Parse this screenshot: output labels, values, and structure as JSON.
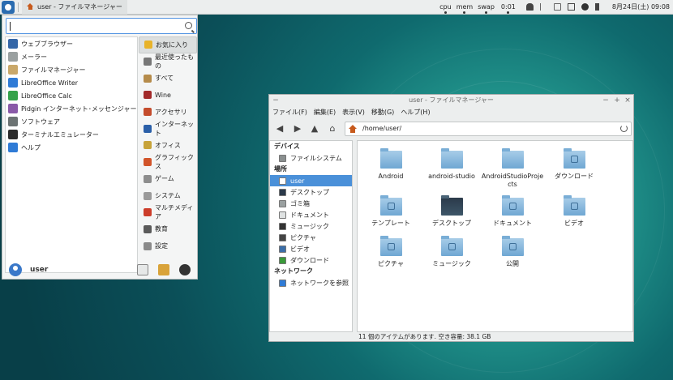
{
  "panel": {
    "task_title": "user - ファイルマネージャー",
    "monitors": [
      "cpu",
      "mem",
      "swap"
    ],
    "uptime": "0:01",
    "clock": "8月24日(土) 09:08"
  },
  "menu": {
    "search": {
      "value": "",
      "placeholder": ""
    },
    "favorites": [
      {
        "label": "ウェブブラウザー",
        "icon": "web-browser-icon",
        "color": "#3567a8"
      },
      {
        "label": "メーラー",
        "icon": "mail-icon",
        "color": "#9aa0a0"
      },
      {
        "label": "ファイルマネージャー",
        "icon": "file-manager-icon",
        "color": "#c9a86a"
      },
      {
        "label": "LibreOffice Writer",
        "icon": "writer-icon",
        "color": "#2f7bd6"
      },
      {
        "label": "LibreOffice Calc",
        "icon": "calc-icon",
        "color": "#35a24a"
      },
      {
        "label": "Pidgin インターネット･メッセンジャー",
        "icon": "pidgin-icon",
        "color": "#8a5aa8"
      },
      {
        "label": "ソフトウェア",
        "icon": "software-icon",
        "color": "#6c7373"
      },
      {
        "label": "ターミナルエミュレーター",
        "icon": "terminal-icon",
        "color": "#2b2b2b"
      },
      {
        "label": "ヘルプ",
        "icon": "help-icon",
        "color": "#2f7bd6"
      }
    ],
    "categories": [
      {
        "label": "お気に入り",
        "icon": "star-icon",
        "color": "#e8b32a",
        "active": true
      },
      {
        "label": "最近使ったもの",
        "icon": "clock-icon",
        "color": "#777777"
      },
      {
        "label": "すべて",
        "icon": "all-apps-icon",
        "color": "#b58b4a"
      },
      {
        "label": "Wine",
        "icon": "wine-icon",
        "color": "#a22a2a"
      },
      {
        "label": "アクセサリ",
        "icon": "accessories-icon",
        "color": "#c44c2c"
      },
      {
        "label": "インターネット",
        "icon": "internet-icon",
        "color": "#2a5fa8"
      },
      {
        "label": "オフィス",
        "icon": "office-icon",
        "color": "#c7a33a"
      },
      {
        "label": "グラフィックス",
        "icon": "graphics-icon",
        "color": "#d1542a"
      },
      {
        "label": "ゲーム",
        "icon": "games-icon",
        "color": "#8d8d8d"
      },
      {
        "label": "システム",
        "icon": "system-icon",
        "color": "#9a9a9a"
      },
      {
        "label": "マルチメディア",
        "icon": "multimedia-icon",
        "color": "#cc3d2a"
      },
      {
        "label": "教育",
        "icon": "education-icon",
        "color": "#5a5a5a"
      },
      {
        "label": "設定",
        "icon": "settings-icon",
        "color": "#8a8a8a"
      }
    ],
    "user": "user"
  },
  "filemanager": {
    "title": "user - ファイルマネージャー",
    "menubar": [
      "ファイル(F)",
      "編集(E)",
      "表示(V)",
      "移動(G)",
      "ヘルプ(H)"
    ],
    "path": "/home/user/",
    "sidebar": {
      "devices_header": "デバイス",
      "devices": [
        {
          "label": "ファイルシステム",
          "icon": "drive-icon"
        }
      ],
      "places_header": "場所",
      "places": [
        {
          "label": "user",
          "icon": "home-icon",
          "active": true
        },
        {
          "label": "デスクトップ",
          "icon": "desktop-icon"
        },
        {
          "label": "ゴミ箱",
          "icon": "trash-icon"
        },
        {
          "label": "ドキュメント",
          "icon": "documents-icon"
        },
        {
          "label": "ミュージック",
          "icon": "music-icon"
        },
        {
          "label": "ピクチャ",
          "icon": "pictures-icon"
        },
        {
          "label": "ビデオ",
          "icon": "videos-icon"
        },
        {
          "label": "ダウンロード",
          "icon": "downloads-icon"
        }
      ],
      "network_header": "ネットワーク",
      "network": [
        {
          "label": "ネットワークを参照",
          "icon": "network-icon"
        }
      ]
    },
    "files": [
      {
        "label": "Android",
        "icon": "folder-icon"
      },
      {
        "label": "android-studio",
        "icon": "folder-icon"
      },
      {
        "label": "AndroidStudioProjects",
        "icon": "folder-icon"
      },
      {
        "label": "ダウンロード",
        "icon": "folder-downloads-icon"
      },
      {
        "label": "テンプレート",
        "icon": "folder-templates-icon"
      },
      {
        "label": "デスクトップ",
        "icon": "folder-desktop-icon"
      },
      {
        "label": "ドキュメント",
        "icon": "folder-documents-icon"
      },
      {
        "label": "ビデオ",
        "icon": "folder-videos-icon"
      },
      {
        "label": "ピクチャ",
        "icon": "folder-pictures-icon"
      },
      {
        "label": "ミュージック",
        "icon": "folder-music-icon"
      },
      {
        "label": "公開",
        "icon": "folder-public-icon"
      }
    ],
    "status": "11 個のアイテムがあります. 空き容量: 38.1 GB"
  }
}
